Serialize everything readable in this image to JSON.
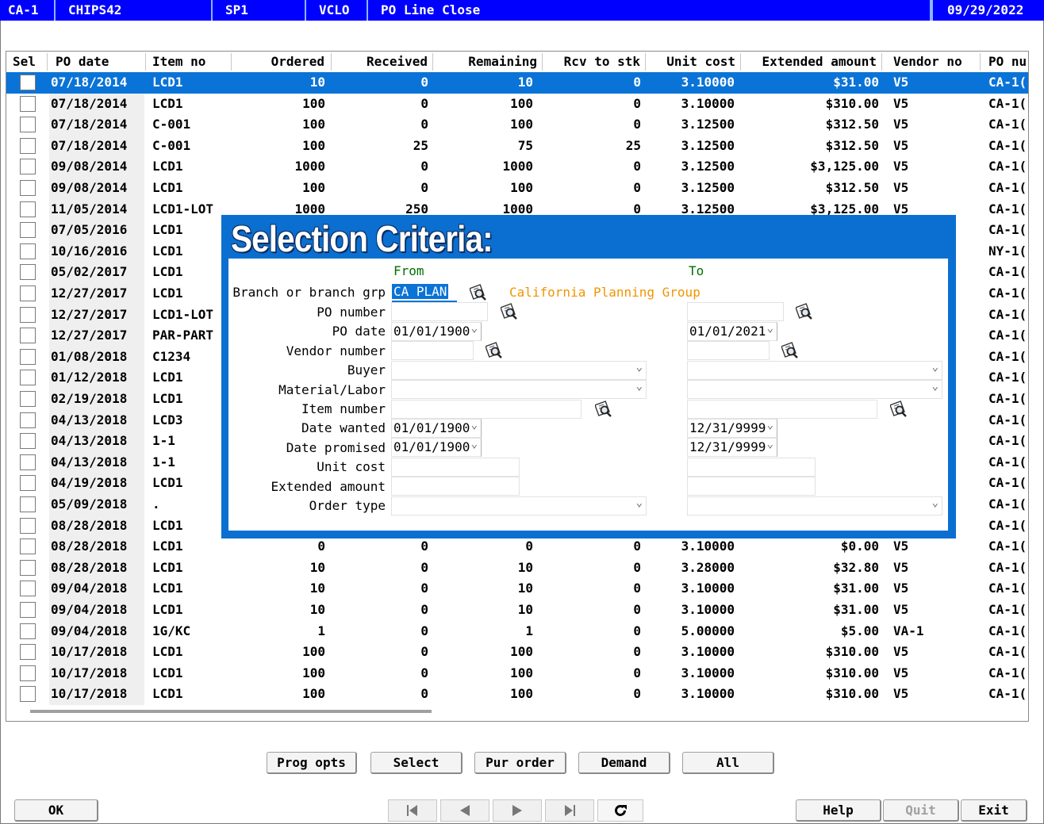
{
  "titlebar": {
    "cells": [
      "CA-1",
      "CHIPS42",
      "SP1",
      "VCLO",
      "PO Line Close",
      "09/29/2022"
    ]
  },
  "grid": {
    "headers": [
      "Sel",
      "PO date",
      "Item no",
      "Ordered",
      "Received",
      "Remaining",
      "Rcv to stk",
      "Unit cost",
      "Extended amount",
      "Vendor no",
      "PO nu"
    ],
    "rows": [
      {
        "date": "07/18/2014",
        "item": "LCD1",
        "ordered": "10",
        "received": "0",
        "remaining": "10",
        "rcv": "0",
        "cost": "3.10000",
        "ext": "$31.00",
        "vendor": "V5",
        "po": "CA-1(",
        "selected": true
      },
      {
        "date": "07/18/2014",
        "item": "LCD1",
        "ordered": "100",
        "received": "0",
        "remaining": "100",
        "rcv": "0",
        "cost": "3.10000",
        "ext": "$310.00",
        "vendor": "V5",
        "po": "CA-1("
      },
      {
        "date": "07/18/2014",
        "item": "C-001",
        "ordered": "100",
        "received": "0",
        "remaining": "100",
        "rcv": "0",
        "cost": "3.12500",
        "ext": "$312.50",
        "vendor": "V5",
        "po": "CA-1("
      },
      {
        "date": "07/18/2014",
        "item": "C-001",
        "ordered": "100",
        "received": "25",
        "remaining": "75",
        "rcv": "25",
        "cost": "3.12500",
        "ext": "$312.50",
        "vendor": "V5",
        "po": "CA-1("
      },
      {
        "date": "09/08/2014",
        "item": "LCD1",
        "ordered": "1000",
        "received": "0",
        "remaining": "1000",
        "rcv": "0",
        "cost": "3.12500",
        "ext": "$3,125.00",
        "vendor": "V5",
        "po": "CA-1("
      },
      {
        "date": "09/08/2014",
        "item": "LCD1",
        "ordered": "100",
        "received": "0",
        "remaining": "100",
        "rcv": "0",
        "cost": "3.12500",
        "ext": "$312.50",
        "vendor": "V5",
        "po": "CA-1("
      },
      {
        "date": "11/05/2014",
        "item": "LCD1-LOT",
        "ordered": "1000",
        "received": "250",
        "remaining": "1000",
        "rcv": "0",
        "cost": "3.12500",
        "ext": "$3,125.00",
        "vendor": "V5",
        "po": "CA-1("
      },
      {
        "date": "07/05/2016",
        "item": "LCD1",
        "ordered": "",
        "received": "",
        "remaining": "",
        "rcv": "",
        "cost": "",
        "ext": "",
        "vendor": "",
        "po": "CA-1("
      },
      {
        "date": "10/16/2016",
        "item": "LCD1",
        "ordered": "",
        "received": "",
        "remaining": "",
        "rcv": "",
        "cost": "",
        "ext": "",
        "vendor": "",
        "po": "NY-1("
      },
      {
        "date": "05/02/2017",
        "item": "LCD1",
        "ordered": "",
        "received": "",
        "remaining": "",
        "rcv": "",
        "cost": "",
        "ext": "",
        "vendor": "",
        "po": "CA-1("
      },
      {
        "date": "12/27/2017",
        "item": "LCD1",
        "ordered": "",
        "received": "",
        "remaining": "",
        "rcv": "",
        "cost": "",
        "ext": "",
        "vendor": "",
        "po": "CA-1("
      },
      {
        "date": "12/27/2017",
        "item": "LCD1-LOT",
        "ordered": "",
        "received": "",
        "remaining": "",
        "rcv": "",
        "cost": "",
        "ext": "",
        "vendor": "",
        "po": "CA-1("
      },
      {
        "date": "12/27/2017",
        "item": "PAR-PART",
        "ordered": "",
        "received": "",
        "remaining": "",
        "rcv": "",
        "cost": "",
        "ext": "",
        "vendor": "",
        "po": "CA-1("
      },
      {
        "date": "01/08/2018",
        "item": "C1234",
        "ordered": "",
        "received": "",
        "remaining": "",
        "rcv": "",
        "cost": "",
        "ext": "",
        "vendor": "",
        "po": "CA-1("
      },
      {
        "date": "01/12/2018",
        "item": "LCD1",
        "ordered": "",
        "received": "",
        "remaining": "",
        "rcv": "",
        "cost": "",
        "ext": "",
        "vendor": "",
        "po": "CA-1("
      },
      {
        "date": "02/19/2018",
        "item": "LCD1",
        "ordered": "",
        "received": "",
        "remaining": "",
        "rcv": "",
        "cost": "",
        "ext": "",
        "vendor": "",
        "po": "CA-1("
      },
      {
        "date": "04/13/2018",
        "item": "LCD3",
        "ordered": "",
        "received": "",
        "remaining": "",
        "rcv": "",
        "cost": "",
        "ext": "",
        "vendor": "",
        "po": "CA-1("
      },
      {
        "date": "04/13/2018",
        "item": "1-1",
        "ordered": "",
        "received": "",
        "remaining": "",
        "rcv": "",
        "cost": "",
        "ext": "",
        "vendor": "",
        "po": "CA-1("
      },
      {
        "date": "04/13/2018",
        "item": "1-1",
        "ordered": "",
        "received": "",
        "remaining": "",
        "rcv": "",
        "cost": "",
        "ext": "",
        "vendor": "",
        "po": "CA-1("
      },
      {
        "date": "04/19/2018",
        "item": "LCD1",
        "ordered": "",
        "received": "",
        "remaining": "",
        "rcv": "",
        "cost": "",
        "ext": "",
        "vendor": "",
        "po": "CA-1("
      },
      {
        "date": "05/09/2018",
        "item": ".",
        "ordered": "",
        "received": "",
        "remaining": "",
        "rcv": "",
        "cost": "",
        "ext": "",
        "vendor": "",
        "po": "CA-1("
      },
      {
        "date": "08/28/2018",
        "item": "LCD1",
        "ordered": "",
        "received": "",
        "remaining": "",
        "rcv": "",
        "cost": "",
        "ext": "",
        "vendor": "",
        "po": "CA-1("
      },
      {
        "date": "08/28/2018",
        "item": "LCD1",
        "ordered": "0",
        "received": "0",
        "remaining": "0",
        "rcv": "0",
        "cost": "3.10000",
        "ext": "$0.00",
        "vendor": "V5",
        "po": "CA-1("
      },
      {
        "date": "08/28/2018",
        "item": "LCD1",
        "ordered": "10",
        "received": "0",
        "remaining": "10",
        "rcv": "0",
        "cost": "3.28000",
        "ext": "$32.80",
        "vendor": "V5",
        "po": "CA-1("
      },
      {
        "date": "09/04/2018",
        "item": "LCD1",
        "ordered": "10",
        "received": "0",
        "remaining": "10",
        "rcv": "0",
        "cost": "3.10000",
        "ext": "$31.00",
        "vendor": "V5",
        "po": "CA-1("
      },
      {
        "date": "09/04/2018",
        "item": "LCD1",
        "ordered": "10",
        "received": "0",
        "remaining": "10",
        "rcv": "0",
        "cost": "3.10000",
        "ext": "$31.00",
        "vendor": "V5",
        "po": "CA-1("
      },
      {
        "date": "09/04/2018",
        "item": "1G/KC",
        "ordered": "1",
        "received": "0",
        "remaining": "1",
        "rcv": "0",
        "cost": "5.00000",
        "ext": "$5.00",
        "vendor": "VA-1",
        "po": "CA-1("
      },
      {
        "date": "10/17/2018",
        "item": "LCD1",
        "ordered": "100",
        "received": "0",
        "remaining": "100",
        "rcv": "0",
        "cost": "3.10000",
        "ext": "$310.00",
        "vendor": "V5",
        "po": "CA-1("
      },
      {
        "date": "10/17/2018",
        "item": "LCD1",
        "ordered": "100",
        "received": "0",
        "remaining": "100",
        "rcv": "0",
        "cost": "3.10000",
        "ext": "$310.00",
        "vendor": "V5",
        "po": "CA-1("
      },
      {
        "date": "10/17/2018",
        "item": "LCD1",
        "ordered": "100",
        "received": "0",
        "remaining": "100",
        "rcv": "0",
        "cost": "3.10000",
        "ext": "$310.00",
        "vendor": "V5",
        "po": "CA-1("
      }
    ]
  },
  "dialog": {
    "title": "Selection Criteria:",
    "from_label": "From",
    "to_label": "To",
    "branch": {
      "label": "Branch or branch grp",
      "value": "CA PLAN",
      "description": "California Planning Group"
    },
    "po_number": {
      "label": "PO number",
      "from": "",
      "to": ""
    },
    "po_date": {
      "label": "PO date",
      "from": "01/01/1900",
      "to": "01/01/2021"
    },
    "vendor_number": {
      "label": "Vendor number",
      "from": "",
      "to": ""
    },
    "buyer": {
      "label": "Buyer",
      "from": "",
      "to": ""
    },
    "material_labor": {
      "label": "Material/Labor",
      "from": "",
      "to": ""
    },
    "item_number": {
      "label": "Item number",
      "from": "",
      "to": ""
    },
    "date_wanted": {
      "label": "Date wanted",
      "from": "01/01/1900",
      "to": "12/31/9999"
    },
    "date_promised": {
      "label": "Date promised",
      "from": "01/01/1900",
      "to": "12/31/9999"
    },
    "unit_cost": {
      "label": "Unit cost",
      "from": "",
      "to": ""
    },
    "extended_amount": {
      "label": "Extended amount",
      "from": "",
      "to": ""
    },
    "order_type": {
      "label": "Order type",
      "from": "",
      "to": ""
    }
  },
  "buttons": {
    "prog_opts": "Prog opts",
    "select": "Select",
    "pur_order": "Pur order",
    "demand": "Demand",
    "all": "All",
    "ok": "OK",
    "help": "Help",
    "quit": "Quit",
    "exit": "Exit"
  },
  "nav_icons": [
    "first-record-icon",
    "previous-record-icon",
    "next-record-icon",
    "last-record-icon",
    "refresh-icon"
  ],
  "colors": {
    "titlebar": "#0000ff",
    "selected_row": "#0a73d7",
    "dialog": "#0a6fd0",
    "green_label": "#007000",
    "orange_text": "#f29400"
  }
}
